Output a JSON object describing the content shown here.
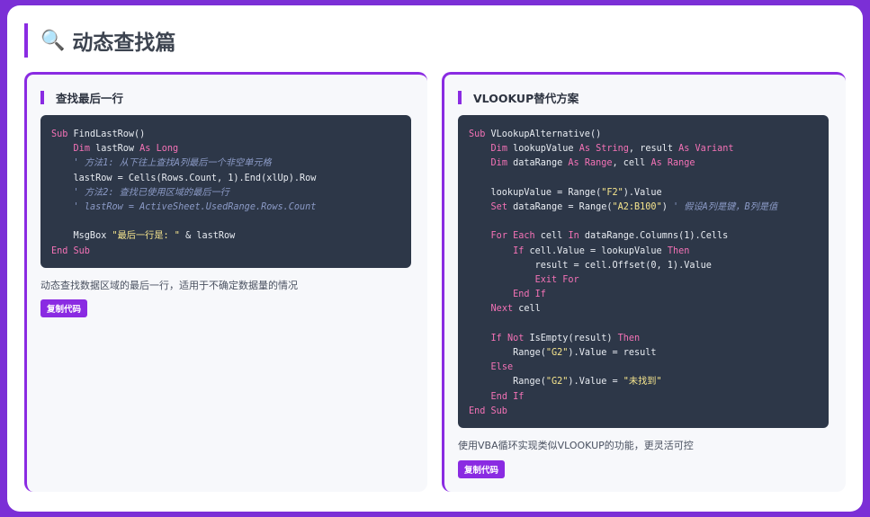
{
  "page": {
    "title": "动态查找篇",
    "title_icon": "🔍"
  },
  "cards": [
    {
      "title": "查找最后一行",
      "description": "动态查找数据区域的最后一行，适用于不确定数据量的情况",
      "copy_label": "复制代码",
      "code": [
        "Sub FindLastRow()",
        "    Dim lastRow As Long",
        "    ' 方法1: 从下往上查找A列最后一个非空单元格",
        "    lastRow = Cells(Rows.Count, 1).End(xlUp).Row",
        "    ' 方法2: 查找已使用区域的最后一行",
        "    ' lastRow = ActiveSheet.UsedRange.Rows.Count",
        "",
        "    MsgBox \"最后一行是: \" & lastRow",
        "End Sub"
      ]
    },
    {
      "title": "VLOOKUP替代方案",
      "description": "使用VBA循环实现类似VLOOKUP的功能，更灵活可控",
      "copy_label": "复制代码",
      "code": [
        "Sub VLookupAlternative()",
        "    Dim lookupValue As String, result As Variant",
        "    Dim dataRange As Range, cell As Range",
        "",
        "    lookupValue = Range(\"F2\").Value",
        "    Set dataRange = Range(\"A2:B100\") ' 假设A列是键，B列是值",
        "",
        "    For Each cell In dataRange.Columns(1).Cells",
        "        If cell.Value = lookupValue Then",
        "            result = cell.Offset(0, 1).Value",
        "            Exit For",
        "        End If",
        "    Next cell",
        "",
        "    If Not IsEmpty(result) Then",
        "        Range(\"G2\").Value = result",
        "    Else",
        "        Range(\"G2\").Value = \"未找到\"",
        "    End If",
        "End Sub"
      ]
    }
  ],
  "colors": {
    "accent": "#8a2be2",
    "code_bg": "#2d3748",
    "keyword": "#f472b6",
    "string": "#f6e58d",
    "comment": "#8b9ac6"
  }
}
